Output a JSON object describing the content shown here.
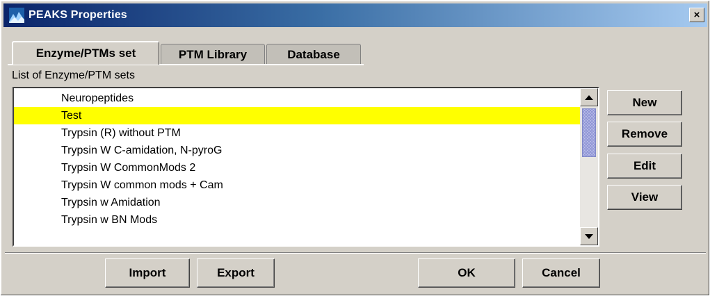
{
  "window": {
    "title": "PEAKS Properties",
    "close_label": "×"
  },
  "tabs": [
    {
      "label": "Enzyme/PTMs set",
      "active": true
    },
    {
      "label": "PTM Library",
      "active": false
    },
    {
      "label": "Database",
      "active": false
    }
  ],
  "list": {
    "caption": "List of Enzyme/PTM sets",
    "items": [
      "Neuropeptides",
      "Test",
      "Trypsin (R) without PTM",
      "Trypsin W C-amidation, N-pyroG",
      "Trypsin W CommonMods 2",
      "Trypsin W common mods + Cam",
      "Trypsin w Amidation",
      "Trypsin w BN Mods"
    ],
    "selected_index": 1
  },
  "side_buttons": {
    "new_label": "New",
    "remove_label": "Remove",
    "edit_label": "Edit",
    "view_label": "View"
  },
  "bottom_buttons": {
    "import_label": "Import",
    "export_label": "Export",
    "ok_label": "OK",
    "cancel_label": "Cancel"
  },
  "colors": {
    "selection": "#ffff00",
    "titlebar_start": "#0a246a",
    "titlebar_end": "#a6caf0",
    "dialog_face": "#d4d0c8"
  }
}
